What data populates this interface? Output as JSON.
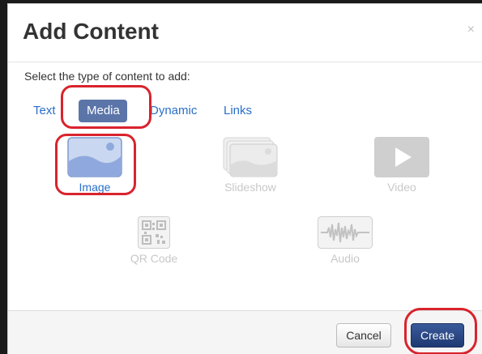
{
  "dialog": {
    "title": "Add Content",
    "close_label": "×",
    "prompt": "Select the type of content to add:"
  },
  "tabs": [
    {
      "label": "Text",
      "active": false
    },
    {
      "label": "Media",
      "active": true
    },
    {
      "label": "Dynamic",
      "active": false
    },
    {
      "label": "Links",
      "active": false
    }
  ],
  "content_types": [
    {
      "label": "Image",
      "icon": "image-icon",
      "enabled": true
    },
    {
      "label": "Slideshow",
      "icon": "slideshow-icon",
      "enabled": false
    },
    {
      "label": "Video",
      "icon": "video-play-icon",
      "enabled": false
    },
    {
      "label": "QR Code",
      "icon": "qr-code-icon",
      "enabled": false
    },
    {
      "label": "Audio",
      "icon": "audio-waveform-icon",
      "enabled": false
    }
  ],
  "footer": {
    "cancel_label": "Cancel",
    "create_label": "Create"
  },
  "colors": {
    "link": "#2a6fc9",
    "active_tab": "#5b75a9",
    "primary_button": "#1f3a73",
    "highlight_ring": "#d9232d",
    "disabled": "#c8c8c8"
  }
}
